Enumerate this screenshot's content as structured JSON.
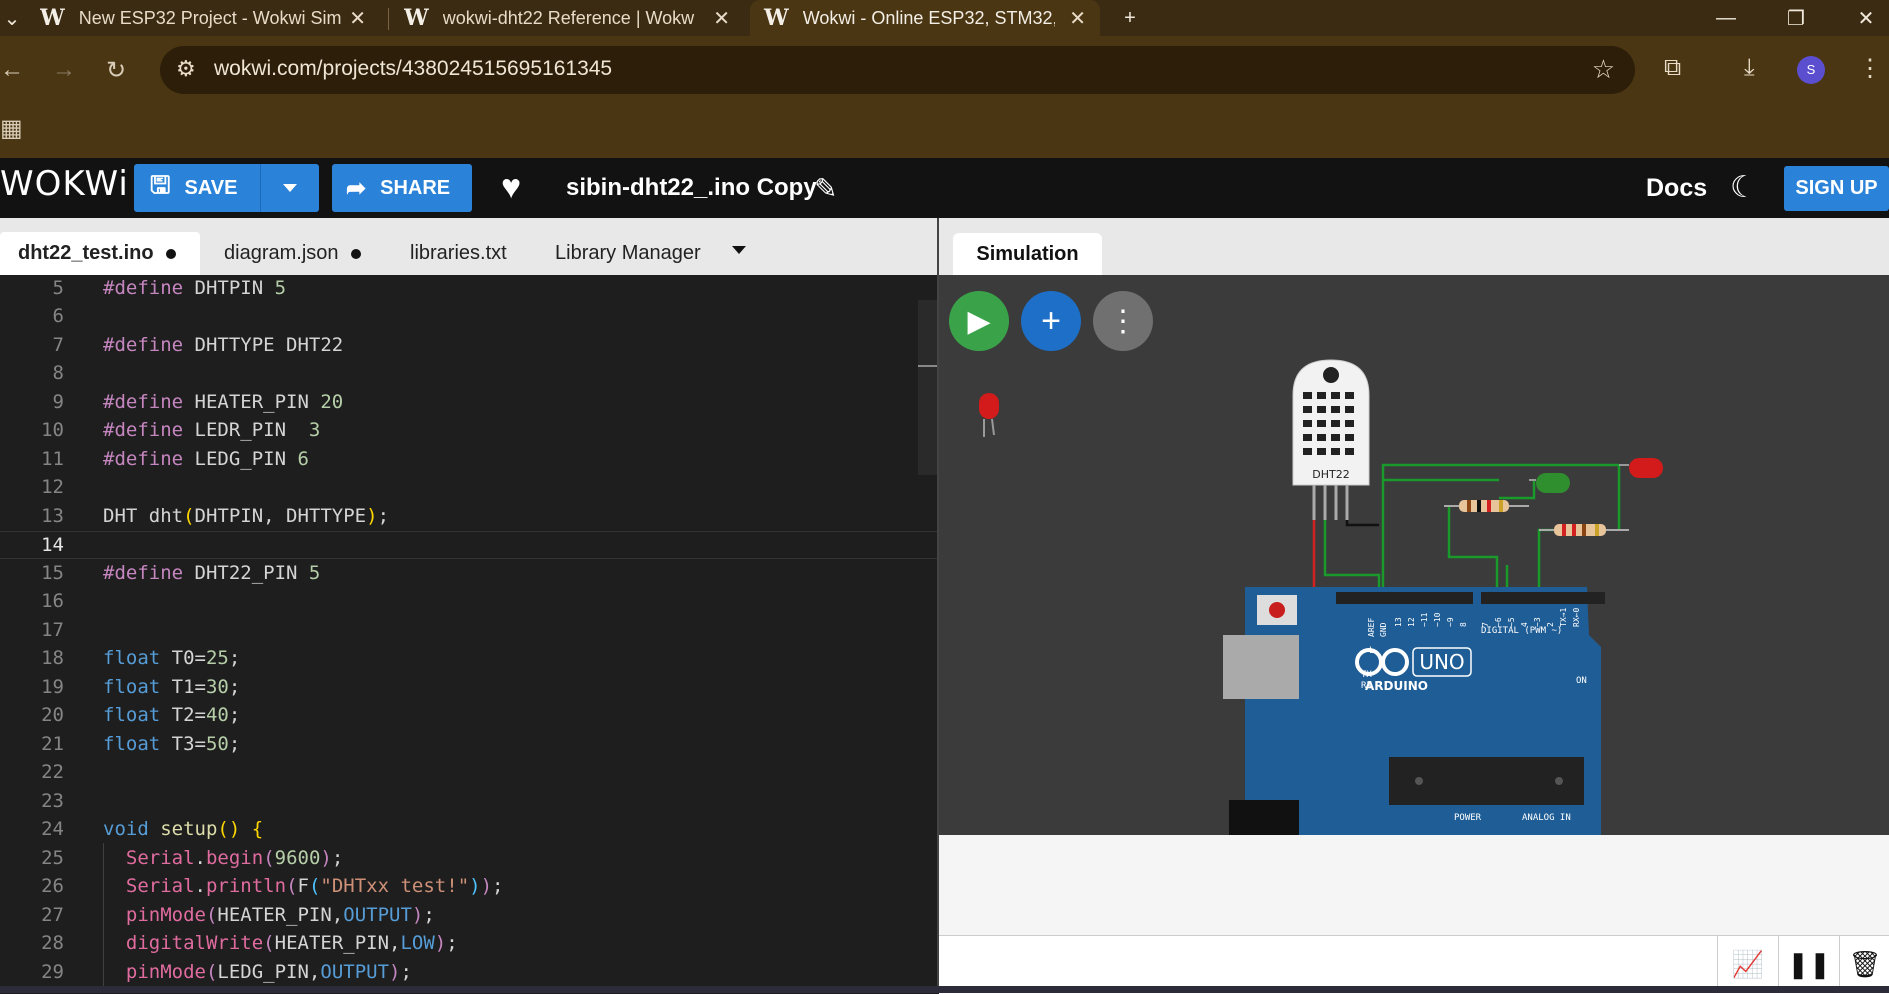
{
  "browser": {
    "tabs": [
      {
        "title": "New ESP32 Project - Wokwi Sim"
      },
      {
        "title": "wokwi-dht22 Reference | Wokw"
      },
      {
        "title": "Wokwi - Online ESP32, STM32, A"
      }
    ],
    "url": "wokwi.com/projects/438024515695161345",
    "avatar_initial": "S"
  },
  "header": {
    "logo": "WOKWi",
    "save_label": "SAVE",
    "share_label": "SHARE",
    "project_title": "sibin-dht22_.ino Copy",
    "docs_label": "Docs",
    "signup_label": "SIGN UP"
  },
  "editor": {
    "tabs": [
      {
        "label": "dht22_test.ino",
        "unsaved": true
      },
      {
        "label": "diagram.json",
        "unsaved": true
      },
      {
        "label": "libraries.txt",
        "unsaved": false
      },
      {
        "label": "Library Manager",
        "unsaved": false
      }
    ],
    "current_line": 14,
    "lines": [
      {
        "n": 5,
        "text": "#define DHTPIN 5"
      },
      {
        "n": 6,
        "text": ""
      },
      {
        "n": 7,
        "text": "#define DHTTYPE DHT22"
      },
      {
        "n": 8,
        "text": ""
      },
      {
        "n": 9,
        "text": "#define HEATER_PIN 20"
      },
      {
        "n": 10,
        "text": "#define LEDR_PIN  3"
      },
      {
        "n": 11,
        "text": "#define LEDG_PIN 6"
      },
      {
        "n": 12,
        "text": ""
      },
      {
        "n": 13,
        "text": "DHT dht(DHTPIN, DHTTYPE);"
      },
      {
        "n": 14,
        "text": ""
      },
      {
        "n": 15,
        "text": "#define DHT22_PIN 5"
      },
      {
        "n": 16,
        "text": ""
      },
      {
        "n": 17,
        "text": ""
      },
      {
        "n": 18,
        "text": "float T0=25;"
      },
      {
        "n": 19,
        "text": "float T1=30;"
      },
      {
        "n": 20,
        "text": "float T2=40;"
      },
      {
        "n": 21,
        "text": "float T3=50;"
      },
      {
        "n": 22,
        "text": ""
      },
      {
        "n": 23,
        "text": ""
      },
      {
        "n": 24,
        "text": "void setup() {"
      },
      {
        "n": 25,
        "text": "  Serial.begin(9600);"
      },
      {
        "n": 26,
        "text": "  Serial.println(F(\"DHTxx test!\"));"
      },
      {
        "n": 27,
        "text": "  pinMode(HEATER_PIN,OUTPUT);"
      },
      {
        "n": 28,
        "text": "  digitalWrite(HEATER_PIN,LOW);"
      },
      {
        "n": 29,
        "text": "  pinMode(LEDG_PIN,OUTPUT);"
      }
    ]
  },
  "simulation": {
    "tab_label": "Simulation",
    "dht_label": "DHT22",
    "board": {
      "uno_label": "UNO",
      "arduino_label": "ARDUINO",
      "digital_label": "DIGITAL (PWM ~)",
      "power_label": "POWER",
      "analog_label": "ANALOG IN",
      "on_label": "ON",
      "l_label": "L",
      "tx_label": "TX",
      "rx_label": "RX",
      "aref_label": "AREF",
      "gnd_label": "GND",
      "pin_labels": [
        "13",
        "12",
        "~11",
        "~10",
        "~9",
        "8",
        "7",
        "~6",
        "~5",
        "4",
        "~3",
        "2",
        "TX→1",
        "RX←0"
      ]
    }
  },
  "colors": {
    "accent_blue": "#2a83d8",
    "play_green": "#3aa34a",
    "board_blue": "#1f5d96"
  },
  "icons": [
    "back-arrow-icon",
    "forward-arrow-icon",
    "reload-icon",
    "site-info-icon",
    "star-icon",
    "extensions-icon",
    "download-icon",
    "menu-dots-icon",
    "apps-grid-icon",
    "save-icon",
    "dropdown-icon",
    "share-icon",
    "heart-icon",
    "pencil-icon",
    "moon-icon",
    "play-icon",
    "plus-icon",
    "more-icon",
    "chart-icon",
    "pause-icon",
    "trash-icon"
  ]
}
